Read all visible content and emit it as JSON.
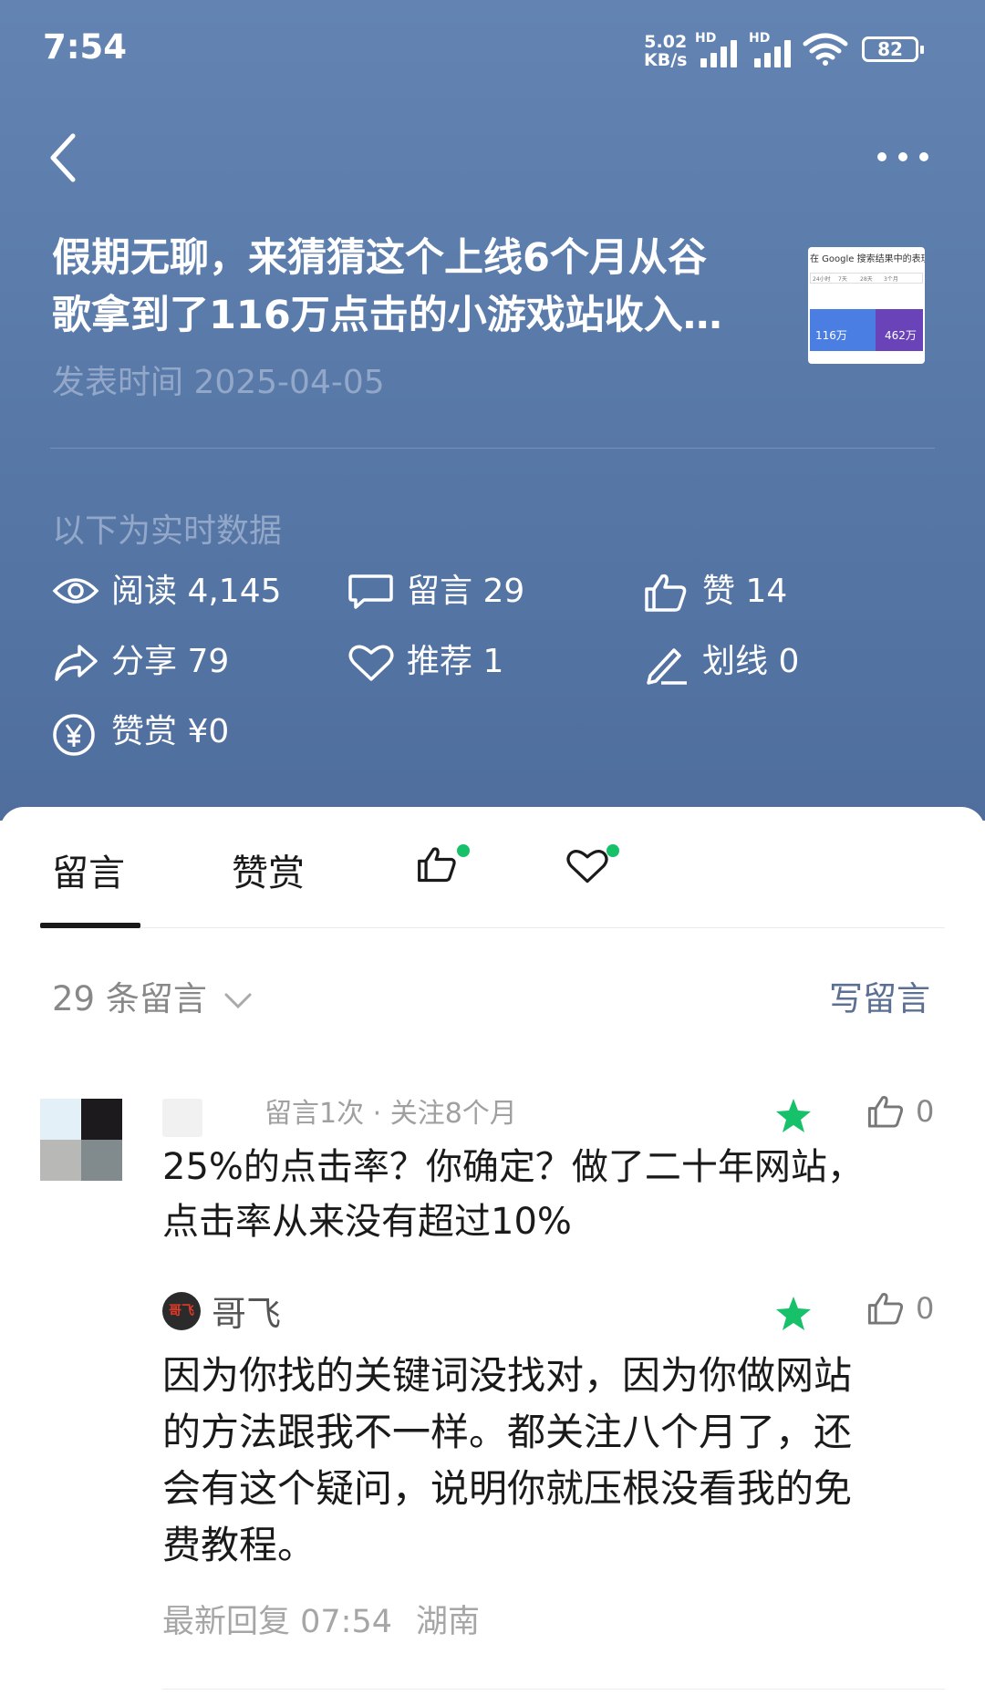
{
  "status_bar": {
    "time": "7:54",
    "speed_value": "5.02",
    "speed_unit": "KB/s",
    "sim1_label": "HD",
    "sim2_label": "HD",
    "battery": "82"
  },
  "header": {
    "back_icon": "chevron-left-icon",
    "more_icon": "more-horizontal-icon"
  },
  "article": {
    "title_line1": "假期无聊，来猜猜这个上线6个月从谷",
    "title_line2": "歌拿到了116万点击的小游戏站收入…",
    "publish_label": "发表时间 2025-04-05",
    "thumbnail": {
      "header_text": "在 Google 搜索结果中的表现",
      "tab1": "24小时",
      "tab2": "7天",
      "tab3": "28天",
      "tab4": "3个月",
      "metric1": "116万",
      "metric2": "462万"
    }
  },
  "realtime": {
    "label": "以下为实时数据",
    "stats": {
      "reads": "阅读 4,145",
      "comments": "留言 29",
      "likes": "赞 14",
      "shares": "分享 79",
      "recommends": "推荐 1",
      "underlines": "划线 0",
      "tips": "赞赏 ¥0"
    }
  },
  "tabs": {
    "comments": "留言",
    "tips": "赞赏",
    "like_icon": "thumbs-up-icon",
    "heart_icon": "heart-icon",
    "dot_color": "#16c169"
  },
  "comments_bar": {
    "count_label": "29 条留言",
    "write_label": "写留言"
  },
  "comment": {
    "meta": "留言1次 · 关注8个月",
    "text_line1": "25%的点击率？你确定？做了二十年网站，",
    "text_line2": "点击率从来没有超过10%",
    "like_count": "0"
  },
  "reply": {
    "avatar_text": "哥飞",
    "name": "哥飞",
    "like_count": "0",
    "text_line1": "因为你找的关键词没找对，因为你做网站",
    "text_line2": "的方法跟我不一样。都关注八个月了，还",
    "text_line3": "会有这个疑问，说明你就压根没看我的免",
    "text_line4": "费教程。",
    "latest_reply": "最新回复 07:54",
    "location": "湖南"
  },
  "colors": {
    "header_bg": "#5a7aaa",
    "star": "#16c169",
    "link": "#5a6f93"
  }
}
